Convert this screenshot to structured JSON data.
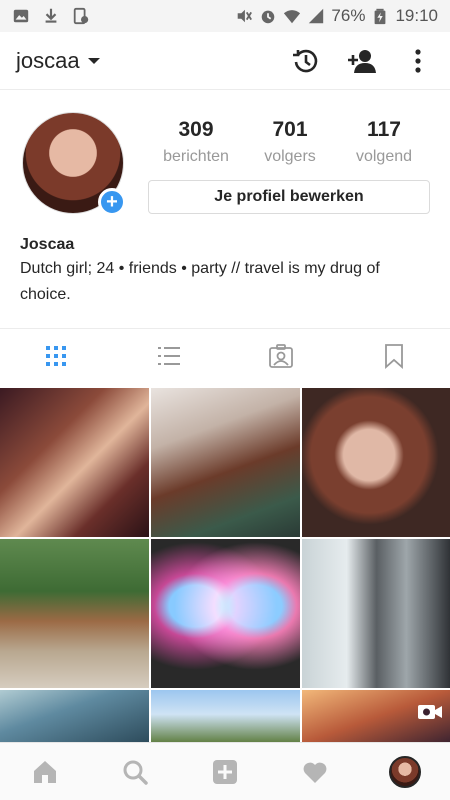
{
  "statusbar": {
    "battery": "76%",
    "time": "19:10",
    "left_icons": [
      "gallery-icon",
      "download-icon",
      "screenshot-icon"
    ],
    "right_icons": [
      "mute-icon",
      "alarm-icon",
      "wifi-icon",
      "signal-icon",
      "battery-icon"
    ]
  },
  "topbar": {
    "username": "joscaa",
    "actions": [
      "history-icon",
      "add-person-icon",
      "more-vert-icon"
    ]
  },
  "profile": {
    "stats": [
      {
        "value": "309",
        "label": "berichten"
      },
      {
        "value": "701",
        "label": "volgers"
      },
      {
        "value": "117",
        "label": "volgend"
      }
    ],
    "edit_button": "Je profiel bewerken",
    "bio_name": "Joscaa",
    "bio_text": "Dutch girl; 24 • friends • party // travel is my drug of choice."
  },
  "tabs": {
    "items": [
      "grid-icon",
      "list-icon",
      "tagged-icon",
      "saved-icon"
    ],
    "active": "grid-icon",
    "active_color": "#3897f0"
  },
  "grid": {
    "tiles": [
      {
        "name": "post-1"
      },
      {
        "name": "post-2"
      },
      {
        "name": "post-3"
      },
      {
        "name": "post-4"
      },
      {
        "name": "post-5"
      },
      {
        "name": "post-6"
      },
      {
        "name": "post-7"
      },
      {
        "name": "post-8"
      },
      {
        "name": "post-9",
        "video": true
      }
    ]
  },
  "bottomnav": {
    "items": [
      "home-icon",
      "search-icon",
      "add-post-icon",
      "activity-icon",
      "profile-avatar"
    ]
  },
  "colors": {
    "accent": "#3897f0",
    "text": "#262626",
    "muted": "#999999"
  }
}
